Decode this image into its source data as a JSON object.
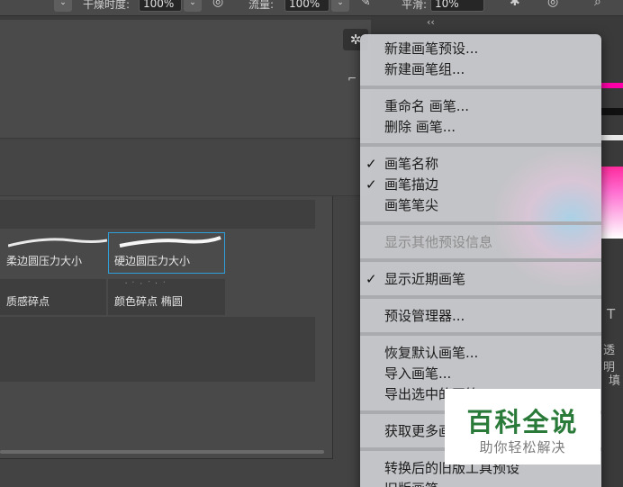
{
  "options_bar": {
    "hardness_label": "干燥时度:",
    "hardness_value": "100%",
    "flow_label": "流量:",
    "flow_value": "100%",
    "smoothing_label": "平滑:",
    "smoothing_value": "10%"
  },
  "brush_panel": {
    "brushes": [
      {
        "name": "柔边圆压力大小",
        "selected": false
      },
      {
        "name": "硬边圆压力大小",
        "selected": true
      },
      {
        "name": "质感碎点",
        "selected": false
      },
      {
        "name": "颜色碎点 椭圆",
        "selected": false
      }
    ]
  },
  "right_panel": {
    "collapse": "‹‹",
    "type_glyph": "T",
    "opacity_fragment": "透明",
    "fill_fragment": "填"
  },
  "context_menu": {
    "groups": [
      [
        {
          "label": "新建画笔预设...",
          "checked": false,
          "disabled": false
        },
        {
          "label": "新建画笔组...",
          "checked": false,
          "disabled": false
        }
      ],
      [
        {
          "label": "重命名 画笔...",
          "checked": false,
          "disabled": false
        },
        {
          "label": "删除 画笔...",
          "checked": false,
          "disabled": false
        }
      ],
      [
        {
          "label": "画笔名称",
          "checked": true,
          "disabled": false
        },
        {
          "label": "画笔描边",
          "checked": true,
          "disabled": false
        },
        {
          "label": "画笔笔尖",
          "checked": false,
          "disabled": false
        }
      ],
      [
        {
          "label": "显示其他预设信息",
          "checked": false,
          "disabled": true
        }
      ],
      [
        {
          "label": "显示近期画笔",
          "checked": true,
          "disabled": false
        }
      ],
      [
        {
          "label": "预设管理器...",
          "checked": false,
          "disabled": false
        }
      ],
      [
        {
          "label": "恢复默认画笔...",
          "checked": false,
          "disabled": false
        },
        {
          "label": "导入画笔...",
          "checked": false,
          "disabled": false
        },
        {
          "label": "导出选中的画笔...",
          "checked": false,
          "disabled": false
        }
      ],
      [
        {
          "label": "获取更多画笔...",
          "checked": false,
          "disabled": false
        }
      ],
      [
        {
          "label": "转换后的旧版工具预设",
          "checked": false,
          "disabled": false
        },
        {
          "label": "旧版画笔",
          "checked": false,
          "disabled": false
        }
      ]
    ],
    "check_glyph": "✓"
  },
  "watermark": {
    "title": "百科全说",
    "subtitle": "助你轻松解决"
  }
}
